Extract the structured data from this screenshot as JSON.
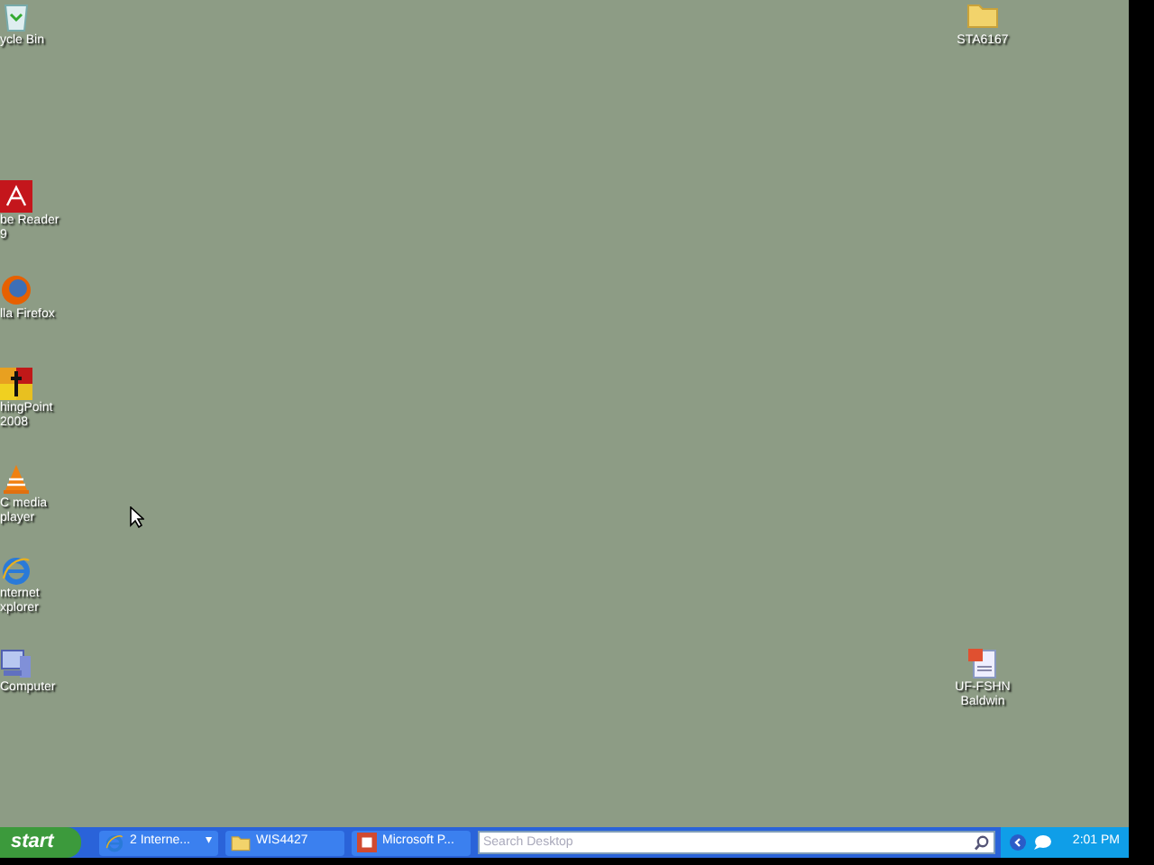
{
  "left_icons": [
    {
      "kind": "recycle-bin",
      "lines": [
        "ycle Bin"
      ]
    },
    {
      "kind": "pdf",
      "lines": [
        "be Reader",
        "9"
      ]
    },
    {
      "kind": "firefox",
      "lines": [
        "lla Firefox"
      ]
    },
    {
      "kind": "turningpoint",
      "lines": [
        "hingPoint",
        "2008"
      ]
    },
    {
      "kind": "vlc",
      "lines": [
        "C media",
        "player"
      ]
    },
    {
      "kind": "ie",
      "lines": [
        "nternet",
        "xplorer"
      ]
    },
    {
      "kind": "computer",
      "lines": [
        "Computer"
      ]
    }
  ],
  "right_icons": [
    {
      "kind": "folder",
      "lines": [
        "STA6167"
      ]
    },
    {
      "kind": "document",
      "lines": [
        "UF-FSHN",
        "Baldwin"
      ]
    }
  ],
  "taskbar": {
    "start": "start",
    "buttons": [
      {
        "kind": "ie",
        "label": "2 Interne...",
        "menu": "▾"
      },
      {
        "kind": "folder",
        "label": "WIS4427"
      },
      {
        "kind": "powerpoint",
        "label": "Microsoft P..."
      }
    ],
    "search": {
      "placeholder": "Search Desktop"
    },
    "clock": "2:01 PM"
  }
}
